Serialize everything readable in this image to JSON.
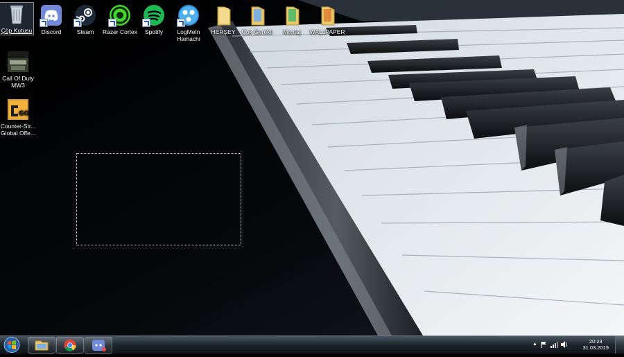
{
  "desktop": {
    "icons_top": [
      {
        "label": "Çöp Kutusu",
        "icon": "recycle-bin-icon"
      },
      {
        "label": "Discord",
        "icon": "discord-icon"
      },
      {
        "label": "Steam",
        "icon": "steam-icon"
      },
      {
        "label": "Razer Cortex",
        "icon": "razer-cortex-icon"
      },
      {
        "label": "Spotify",
        "icon": "spotify-icon"
      },
      {
        "label": "LogMeIn Hamachi",
        "icon": "hamachi-icon"
      },
      {
        "label": "HERŞEY",
        "icon": "folder-icon"
      },
      {
        "label": "Çok Gerekli",
        "icon": "folder-icon"
      },
      {
        "label": "Montaj",
        "icon": "folder-icon"
      },
      {
        "label": "WALLPAPER",
        "icon": "folder-icon"
      }
    ],
    "icons_left": [
      {
        "label": "Call Of Duty MW3",
        "icon": "cod-mw3-icon"
      },
      {
        "label": "Counter-Str... Global Offe...",
        "icon": "csgo-icon"
      }
    ]
  },
  "taskbar": {
    "pinned": [
      "folder-icon",
      "chrome-icon",
      "discord-icon"
    ],
    "clock_time": "20:23",
    "clock_date": "31.03.2019",
    "tray_icons": [
      "show-hidden-icons",
      "action-center-flag-icon",
      "network-icon",
      "volume-icon"
    ]
  },
  "colors": {
    "discord": "#7289da",
    "spotify": "#1db954",
    "razer": "#44d62c",
    "taskbar": "#1d252c"
  }
}
